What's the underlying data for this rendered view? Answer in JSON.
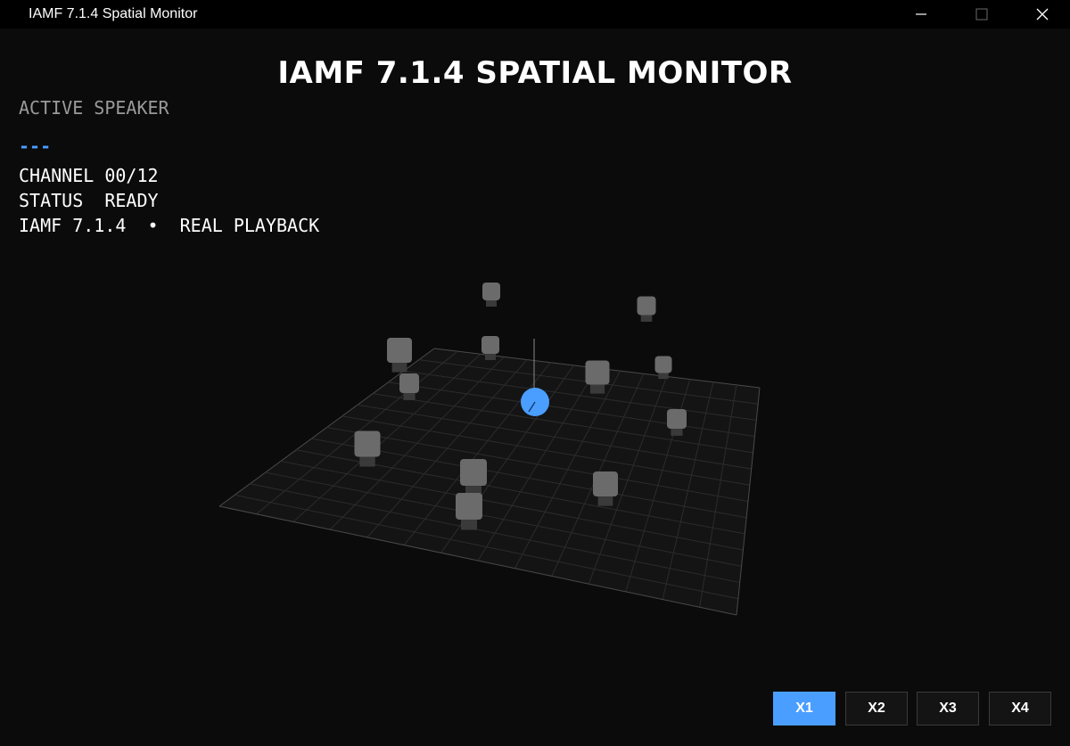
{
  "window": {
    "title": "IAMF 7.1.4 Spatial Monitor"
  },
  "heading": "IAMF 7.1.4 SPATIAL MONITOR",
  "info": {
    "active_label": "ACTIVE SPEAKER",
    "active_name": "---",
    "channel": "CHANNEL 00/12",
    "status": "STATUS  READY",
    "format": "IAMF 7.1.4  •  REAL PLAYBACK"
  },
  "scene": {
    "speaker_count": 12,
    "listener_color": "#4a9eff",
    "speaker_color": "#6e6e6e"
  },
  "zoom": {
    "buttons": [
      "X1",
      "X2",
      "X3",
      "X4"
    ],
    "active": "X1"
  },
  "colors": {
    "accent": "#4a9eff",
    "background": "#0b0b0b",
    "grid": "#3a3a3a"
  }
}
